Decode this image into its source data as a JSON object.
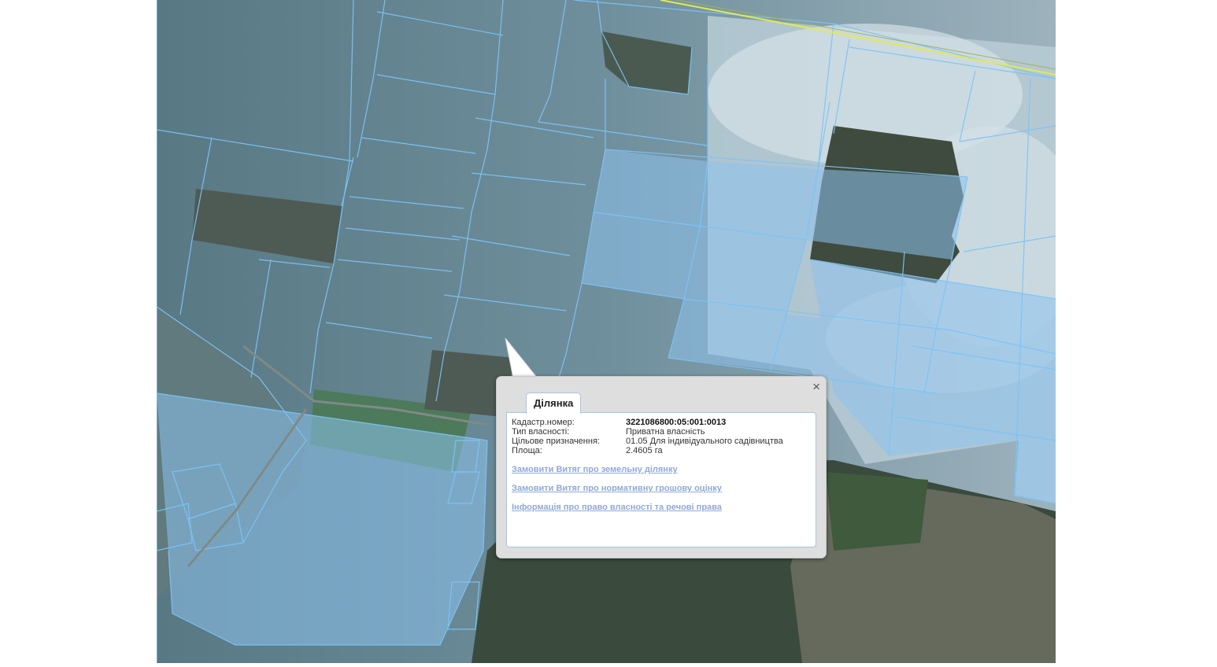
{
  "map": {
    "colors": {
      "parcel_outline": "#7cc4f6",
      "parcel_fill": "#9ccaf0",
      "road": "#e4ea4c",
      "field_dark": "#5a6f78",
      "field_light": "#c9d7df",
      "forest": "#2c3d2e"
    }
  },
  "popup": {
    "tab_label": "Ділянка",
    "close_icon": "×",
    "fields": [
      {
        "label": "Кадастр.номер:",
        "value": "3221086800:05:001:0013"
      },
      {
        "label": "Тип власності:",
        "value": "Приватна власність"
      },
      {
        "label": "Цільове призначення:",
        "value": "01.05 Для індивідуального садівництва"
      },
      {
        "label": "Площа:",
        "value": "2.4605 га"
      }
    ],
    "links": [
      "Замовити Витяг про земельну ділянку",
      "Замовити Витяг про нормативну грошову оцінку",
      "Інформація про право власності та речові права"
    ]
  }
}
